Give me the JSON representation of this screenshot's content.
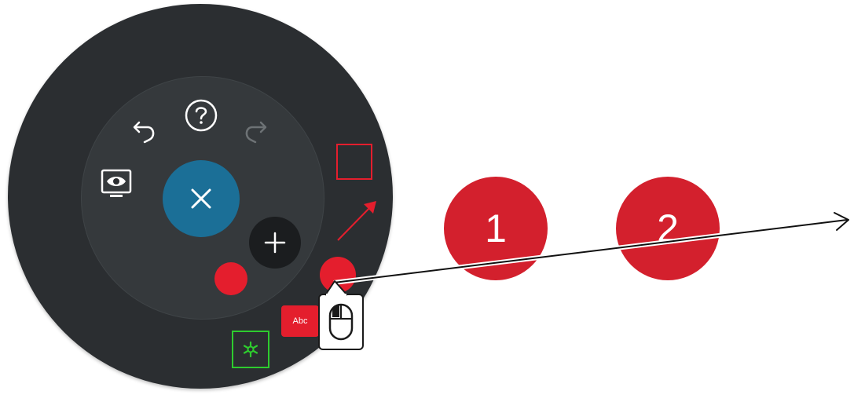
{
  "radial_menu": {
    "center_icon": "close-icon",
    "icons": [
      "help-icon",
      "undo-icon",
      "redo-icon",
      "eye-screen-icon",
      "plus-icon"
    ],
    "tools": {
      "rectangle": "rectangle-icon",
      "arrow": "arrow-icon",
      "text_label": "Abc",
      "green_tool": "asterisk-icon"
    },
    "colors": {
      "dark": "#2b2e31",
      "inner": "#35393c",
      "accent_blue": "#1b6f97",
      "accent_red": "#e41e2d",
      "green": "#2ecc2e"
    }
  },
  "callouts": [
    {
      "label": "1"
    },
    {
      "label": "2"
    }
  ],
  "cursor": {
    "icon": "mouse-icon"
  }
}
